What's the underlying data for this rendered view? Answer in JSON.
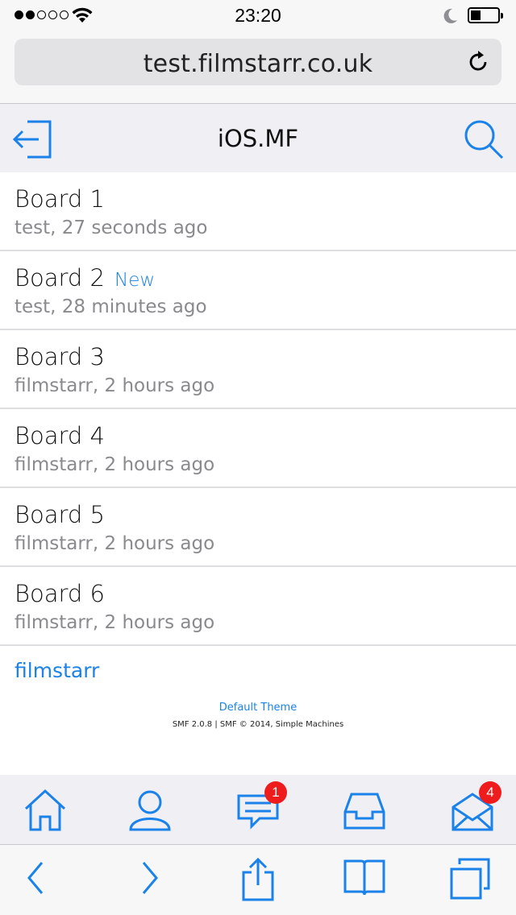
{
  "status_bar": {
    "time": "23:20",
    "signal_icon": "signal-dots",
    "wifi_icon": "wifi-icon",
    "dnd_icon": "moon-icon",
    "battery_icon": "battery-icon"
  },
  "browser": {
    "url": "test.filmstarr.co.uk",
    "reload_icon": "reload-icon"
  },
  "header": {
    "title": "iOS.MF",
    "logout_icon": "logout-icon",
    "search_icon": "search-icon"
  },
  "boards": [
    {
      "name": "Board 1",
      "meta": "test, 27 seconds ago",
      "new": ""
    },
    {
      "name": "Board 2",
      "meta": "test, 28 minutes ago",
      "new": "New"
    },
    {
      "name": "Board 3",
      "meta": "filmstarr, 2 hours ago",
      "new": ""
    },
    {
      "name": "Board 4",
      "meta": "filmstarr, 2 hours ago",
      "new": ""
    },
    {
      "name": "Board 5",
      "meta": "filmstarr, 2 hours ago",
      "new": ""
    },
    {
      "name": "Board 6",
      "meta": "filmstarr, 2 hours ago",
      "new": ""
    }
  ],
  "footer": {
    "user": "filmstarr",
    "theme": "Default Theme",
    "copyright": "SMF 2.0.8 | SMF © 2014, Simple Machines"
  },
  "tabbar": {
    "items": [
      {
        "icon": "home-icon",
        "badge": ""
      },
      {
        "icon": "profile-icon",
        "badge": ""
      },
      {
        "icon": "messages-icon",
        "badge": "1"
      },
      {
        "icon": "inbox-icon",
        "badge": ""
      },
      {
        "icon": "mail-icon",
        "badge": "4"
      }
    ]
  },
  "toolbar": {
    "items": [
      "back-icon",
      "forward-icon",
      "share-icon",
      "bookmarks-icon",
      "tabs-icon"
    ]
  },
  "colors": {
    "accent": "#1a82e8",
    "badge": "#ee1c1c",
    "meta_text": "#8a8a8e"
  }
}
